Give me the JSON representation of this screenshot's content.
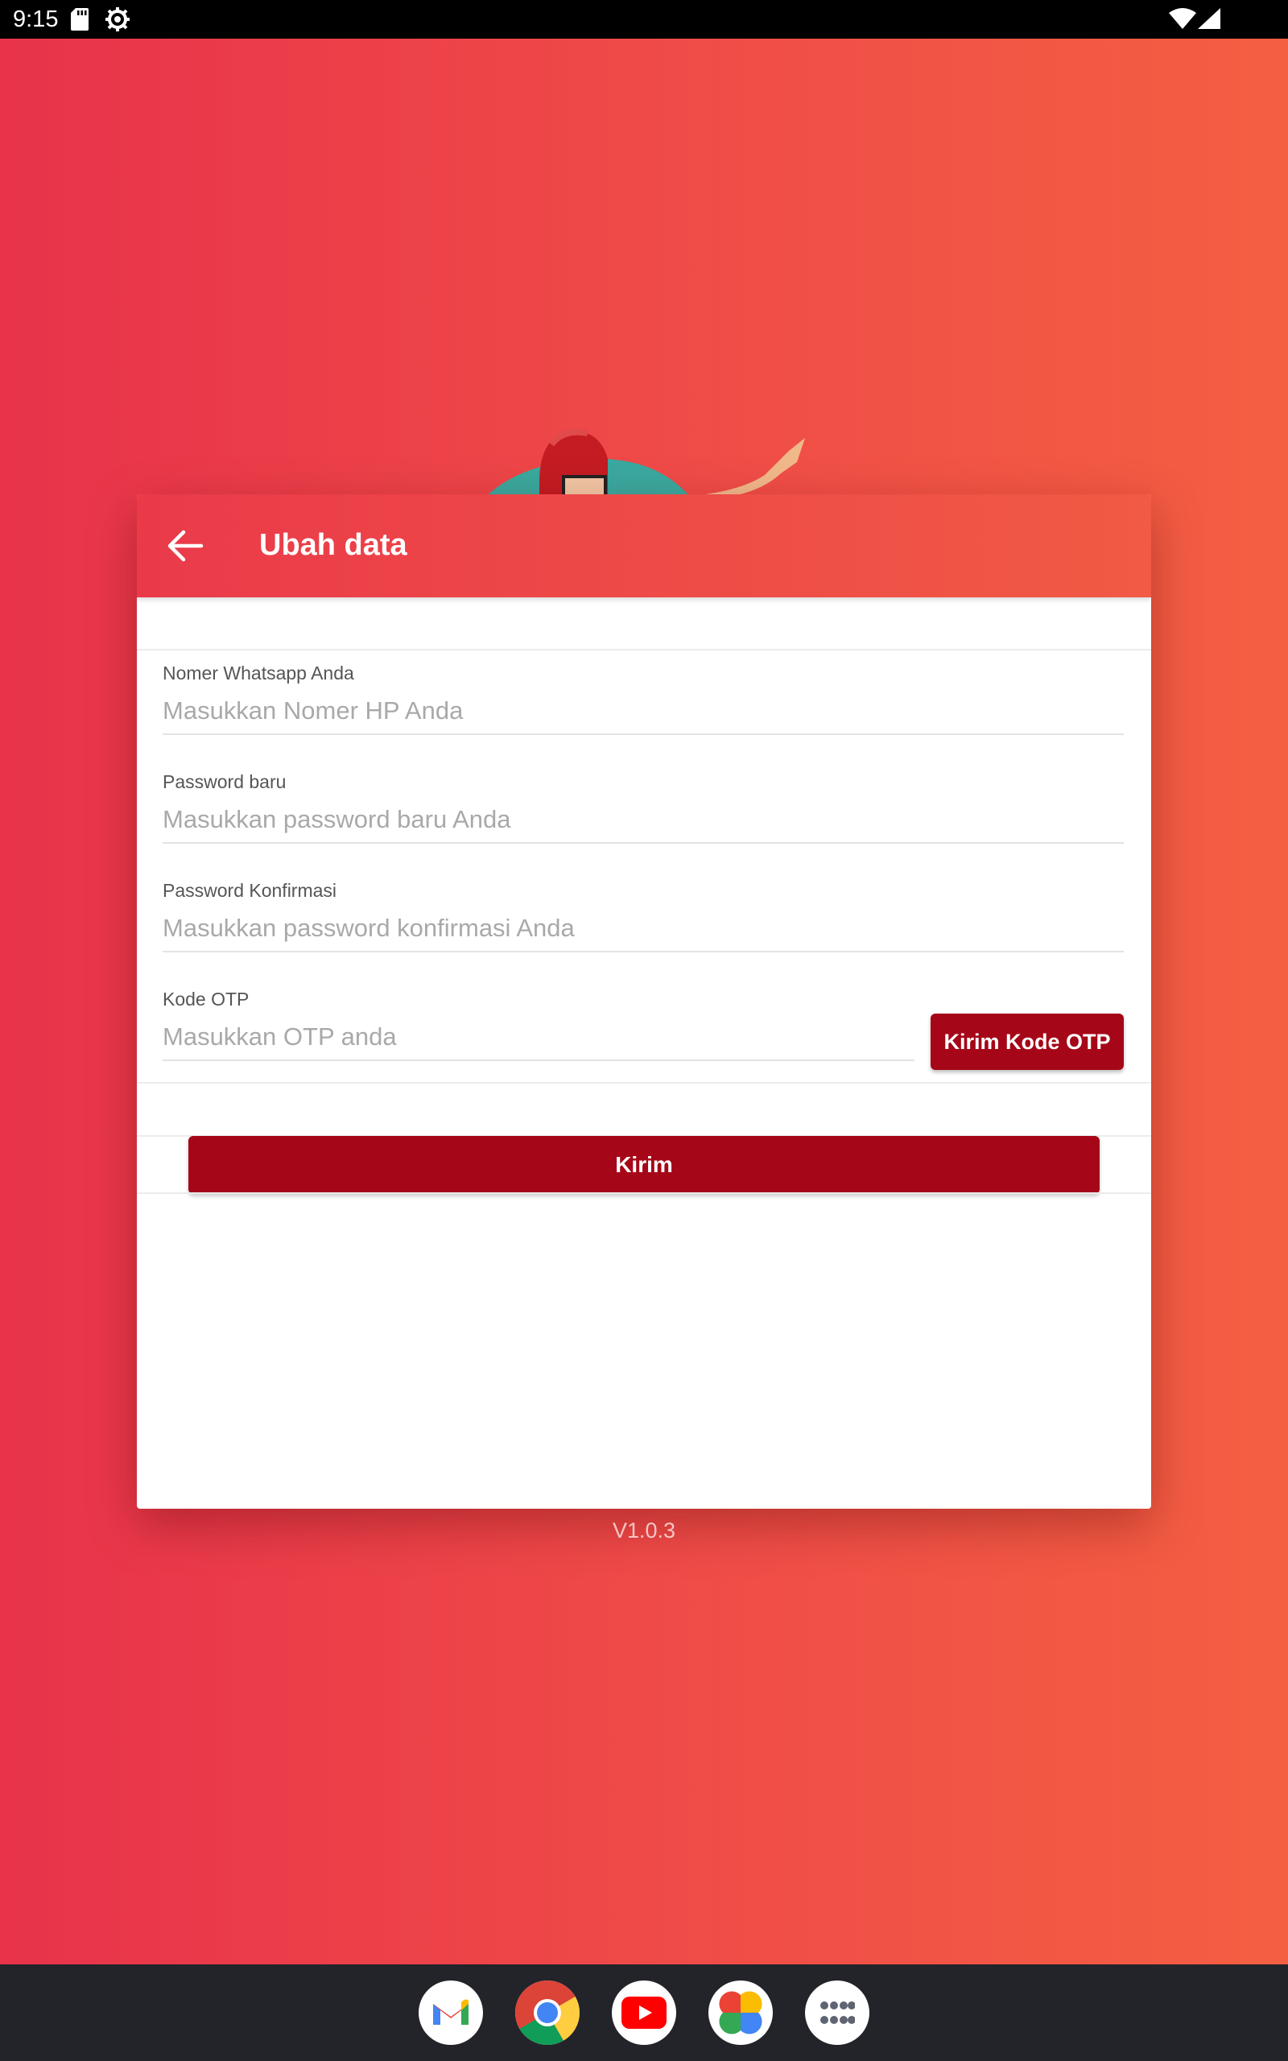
{
  "status_bar": {
    "time": "9:15"
  },
  "dialog": {
    "title": "Ubah data",
    "fields": [
      {
        "label": "Nomer Whatsapp Anda",
        "placeholder": "Masukkan Nomer HP Anda",
        "value": ""
      },
      {
        "label": "Password baru",
        "placeholder": "Masukkan password baru Anda",
        "value": ""
      },
      {
        "label": "Password Konfirmasi",
        "placeholder": "Masukkan password konfirmasi Anda",
        "value": ""
      },
      {
        "label": "Kode OTP",
        "placeholder": "Masukkan OTP anda",
        "value": ""
      }
    ],
    "otp_button_label": "Kirim Kode OTP",
    "submit_label": "Kirim"
  },
  "version": "V1.0.3",
  "colors": {
    "primary": "#a50718",
    "header_start": "#ea3a4a",
    "header_end": "#f15a44"
  },
  "dock": {
    "apps": [
      "gmail-icon",
      "chrome-icon",
      "youtube-icon",
      "photos-icon",
      "app-drawer-icon"
    ]
  }
}
